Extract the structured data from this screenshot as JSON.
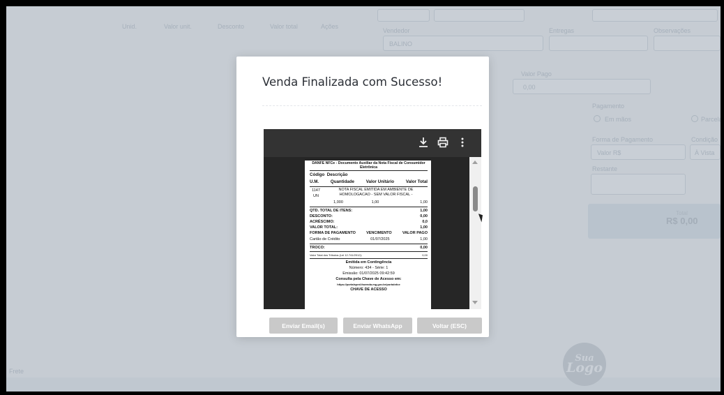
{
  "background_app": {
    "column_headers": [
      "Unid.",
      "Valor unit.",
      "Desconto",
      "Valor total",
      "Ações"
    ],
    "top_right_tabs": [
      "Vendedor",
      "Entregas",
      "Observações"
    ],
    "vendedor_value": "BALINO",
    "label_preco": "Valor Pago",
    "label_valor": "0,00",
    "label_pagamento": "Pagamento",
    "radio_1_label": "Em mãos",
    "radio_2_label": "Parcelado",
    "label_forma": "Forma de Pagamento",
    "label_condicao": "Condição",
    "select_forma": "Valor R$",
    "select_condicao": "À Vista",
    "label_restante": "Restante",
    "total_label": "Total",
    "total_value": "R$ 0,00",
    "bottom_left_label": "Frete",
    "logo_line1": "Sua",
    "logo_line2": "Logo"
  },
  "modal": {
    "title": "Venda Finalizada com Sucesso!",
    "buttons": {
      "email": "Enviar Email(s)",
      "whatsapp": "Enviar WhatsApp",
      "back": "Voltar (ESC)"
    },
    "viewer": {
      "toolbar_icons": [
        "download-icon",
        "print-icon",
        "more-icon"
      ],
      "receipt": {
        "header": "DANFE NFCe - Documento Auxiliar da Nota Fiscal de Consumidor Eletrônica",
        "col_codigo": "Código",
        "col_descricao": "Descrição",
        "col_um": "U.M.",
        "col_quantidade": "Quantidade",
        "col_valor_unitario": "Valor Unitário",
        "col_valor_total": "Valor Total",
        "item_code": "1147",
        "item_unit": "UN",
        "item_desc": "NOTA FISCAL EMITIDA EM AMBIENTE DE HOMOLOGACAO - SEM VALOR FISCAL -",
        "item_qty": "1,000",
        "item_unit_price": "1,00",
        "item_total": "1,00",
        "qtd_label": "QTD. TOTAL DE ITENS:",
        "qtd_value": "1,00",
        "desconto_label": "DESCONTO:",
        "desconto_value": "0,00",
        "acrescimo_label": "ACRÉSCIMO:",
        "acrescimo_value": "0,0",
        "valor_total_label": "VALOR TOTAL:",
        "valor_total_value": "1,00",
        "pay_col_forma": "FORMA DE PAGAMENTO",
        "pay_col_venc": "VENCIMENTO",
        "pay_col_valor": "VALOR PAGO",
        "pay_forma": "Cartão de Crédito",
        "pay_venc": "01/07/2025",
        "pay_valor": "1,00",
        "troco_label": "TROCO:",
        "troco_value": "0,00",
        "tributos_label": "Valor Total dos Tributos (Lei 12.741/2012):",
        "tributos_value": "0,00",
        "contingencia": "Emitida em Contingência",
        "numero": "Número: 434 - Série: 1",
        "emissao": "Emissão: 01/07/2025 09:42:59",
        "consulta": "Consulta pela Chave de Acesso em:",
        "url": "https://portalsped.fazenda.mg.gov.br/portalnfce",
        "chave": "CHAVE DE ACESSO"
      }
    }
  }
}
